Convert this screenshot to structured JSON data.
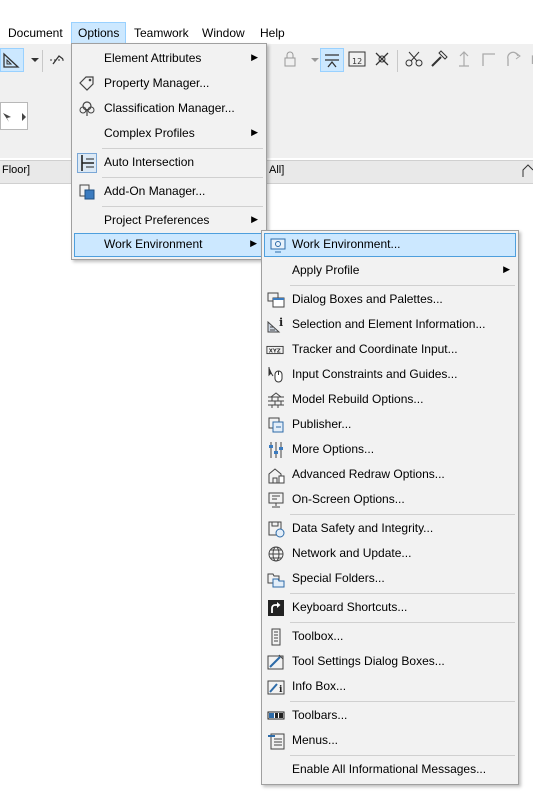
{
  "menubar": {
    "items": [
      "Document",
      "Options",
      "Teamwork",
      "Window",
      "Help"
    ]
  },
  "tabstrip": {
    "left_text": "Floor]",
    "mid_text": "All]"
  },
  "options_menu": {
    "items": [
      {
        "label": "Element Attributes",
        "icon": "none",
        "submenu": true
      },
      {
        "label": "Property Manager...",
        "icon": "tag-icon",
        "submenu": false
      },
      {
        "label": "Classification Manager...",
        "icon": "tree-icon",
        "submenu": false
      },
      {
        "label": "Complex Profiles",
        "icon": "none",
        "submenu": true
      },
      {
        "label": "Auto Intersection",
        "icon": "intersection-icon",
        "submenu": false
      },
      {
        "label": "Add-On Manager...",
        "icon": "addon-icon",
        "submenu": false
      },
      {
        "label": "Project Preferences",
        "icon": "none",
        "submenu": true
      },
      {
        "label": "Work Environment",
        "icon": "none",
        "submenu": true
      }
    ]
  },
  "work_env_menu": {
    "items": [
      {
        "label": "Work Environment...",
        "icon": "work-environment-icon"
      },
      {
        "label": "Apply Profile",
        "icon": "none",
        "submenu": true
      },
      {
        "label": "Dialog Boxes and Palettes...",
        "icon": "palettes-icon"
      },
      {
        "label": "Selection and Element Information...",
        "icon": "selection-info-icon"
      },
      {
        "label": "Tracker and Coordinate Input...",
        "icon": "xyz-icon"
      },
      {
        "label": "Input Constraints and Guides...",
        "icon": "mouse-icon"
      },
      {
        "label": "Model Rebuild Options...",
        "icon": "bricks-icon"
      },
      {
        "label": "Publisher...",
        "icon": "publisher-icon"
      },
      {
        "label": "More Options...",
        "icon": "sliders-icon"
      },
      {
        "label": "Advanced Redraw Options...",
        "icon": "house-redraw-icon"
      },
      {
        "label": "On-Screen Options...",
        "icon": "monitor-icon"
      },
      {
        "label": "Data Safety and Integrity...",
        "icon": "save-shield-icon"
      },
      {
        "label": "Network and Update...",
        "icon": "globe-icon"
      },
      {
        "label": "Special Folders...",
        "icon": "folders-icon"
      },
      {
        "label": "Keyboard Shortcuts...",
        "icon": "shortcut-arrow-icon"
      },
      {
        "label": "Toolbox...",
        "icon": "toolbox-icon"
      },
      {
        "label": "Tool Settings Dialog Boxes...",
        "icon": "tool-settings-icon"
      },
      {
        "label": "Info Box...",
        "icon": "info-box-icon"
      },
      {
        "label": "Toolbars...",
        "icon": "toolbars-icon"
      },
      {
        "label": "Menus...",
        "icon": "menus-icon"
      },
      {
        "label": "Enable All Informational Messages...",
        "icon": "none"
      }
    ]
  },
  "colors": {
    "highlight_bg": "#cce8ff",
    "highlight_border": "#4e9fdd",
    "menu_bg": "#f2f2f2"
  }
}
